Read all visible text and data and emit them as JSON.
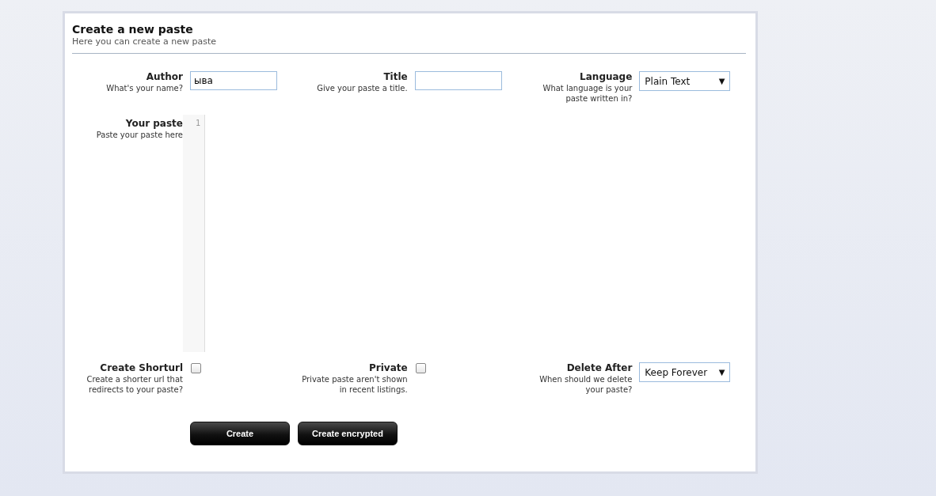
{
  "form": {
    "title": "Create a new paste",
    "subtitle": "Here you can create a new paste"
  },
  "top_fields": [
    {
      "kind": "text",
      "label": "Author",
      "hint": "What's your name?",
      "value": "ыва"
    },
    {
      "kind": "text",
      "label": "Title",
      "hint": "Give your paste a title."
    },
    {
      "kind": "select",
      "label": "Language",
      "hint": "What language is your paste written in?",
      "value": "Plain Text",
      "arrow": "▼"
    }
  ],
  "paste": {
    "label": "Your paste",
    "hint": "Paste your paste here",
    "line_numbers": [
      "1"
    ]
  },
  "bottom_fields": [
    {
      "kind": "checkbox",
      "label": "Create Shorturl",
      "hint": "Create a shorter url that redirects to your paste?",
      "checked": false
    },
    {
      "kind": "checkbox",
      "label": "Private",
      "hint": "Private paste aren't shown in recent listings.",
      "checked": false
    },
    {
      "kind": "select",
      "label": "Delete After",
      "hint": "When should we delete your paste?",
      "value": "Keep Forever",
      "arrow": "▼"
    }
  ],
  "buttons": [
    "Create",
    "Create encrypted"
  ]
}
